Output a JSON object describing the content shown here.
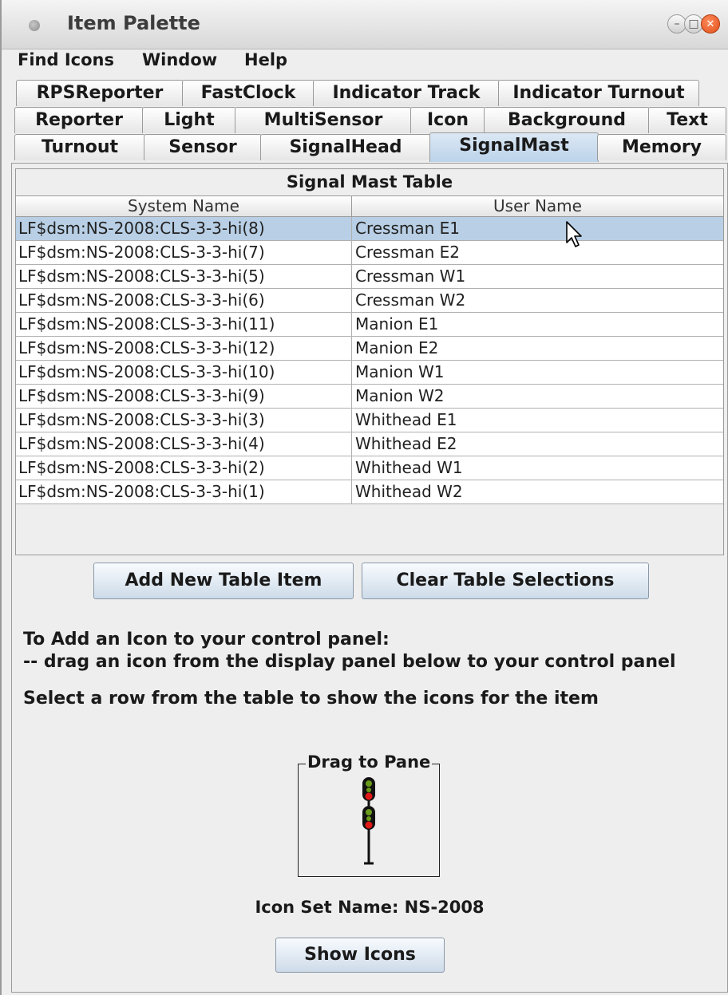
{
  "window": {
    "title": "Item Palette",
    "controls": [
      "minimize-icon",
      "maximize-icon",
      "close-icon"
    ]
  },
  "menubar": {
    "items": [
      "Find Icons",
      "Window",
      "Help"
    ]
  },
  "tabs": {
    "rows": [
      [
        "RPSReporter",
        "FastClock",
        "Indicator Track",
        "Indicator Turnout"
      ],
      [
        "Reporter",
        "Light",
        "MultiSensor",
        "Icon",
        "Background",
        "Text"
      ],
      [
        "Turnout",
        "Sensor",
        "SignalHead",
        "SignalMast",
        "Memory"
      ]
    ],
    "selected": "SignalMast"
  },
  "table": {
    "title": "Signal Mast Table",
    "columns": [
      "System Name",
      "User Name"
    ],
    "selected_row": 0,
    "rows": [
      [
        "LF$dsm:NS-2008:CLS-3-3-hi(8)",
        "Cressman E1"
      ],
      [
        "LF$dsm:NS-2008:CLS-3-3-hi(7)",
        "Cressman E2"
      ],
      [
        "LF$dsm:NS-2008:CLS-3-3-hi(5)",
        "Cressman W1"
      ],
      [
        "LF$dsm:NS-2008:CLS-3-3-hi(6)",
        "Cressman W2"
      ],
      [
        "LF$dsm:NS-2008:CLS-3-3-hi(11)",
        "Manion E1"
      ],
      [
        "LF$dsm:NS-2008:CLS-3-3-hi(12)",
        "Manion E2"
      ],
      [
        "LF$dsm:NS-2008:CLS-3-3-hi(10)",
        "Manion W1"
      ],
      [
        "LF$dsm:NS-2008:CLS-3-3-hi(9)",
        "Manion W2"
      ],
      [
        "LF$dsm:NS-2008:CLS-3-3-hi(3)",
        "Whithead E1"
      ],
      [
        "LF$dsm:NS-2008:CLS-3-3-hi(4)",
        "Whithead E2"
      ],
      [
        "LF$dsm:NS-2008:CLS-3-3-hi(2)",
        "Whithead W1"
      ],
      [
        "LF$dsm:NS-2008:CLS-3-3-hi(1)",
        "Whithead W2"
      ]
    ]
  },
  "buttons": {
    "add_new": "Add New Table Item",
    "clear_selections": "Clear Table Selections",
    "show_icons": "Show Icons"
  },
  "instructions": {
    "line1": "To Add an Icon to your control panel:",
    "line2": "-- drag an icon from the display panel below to your control panel",
    "line3": "Select a row from the table to show the icons for the item"
  },
  "preview": {
    "title": "Drag to Pane",
    "icon": "signal-mast-icon",
    "icon_set_label": "Icon Set Name: NS-2008"
  },
  "colors": {
    "selected_row": "#b8cfe5",
    "selected_tab": "#bcd3ea",
    "close_button": "#e0501c",
    "signal_red": "#e01818",
    "signal_green": "#6a9a1a"
  }
}
